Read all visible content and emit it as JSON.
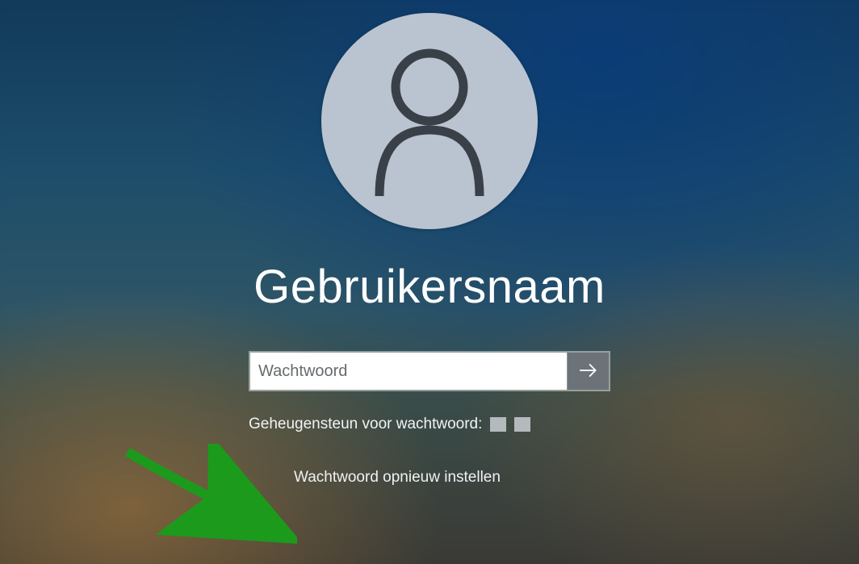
{
  "login": {
    "username": "Gebruikersnaam",
    "password_placeholder": "Wachtwoord",
    "password_value": "",
    "hint_label": "Geheugensteun voor wachtwoord:",
    "reset_link": "Wachtwoord opnieuw instellen"
  }
}
